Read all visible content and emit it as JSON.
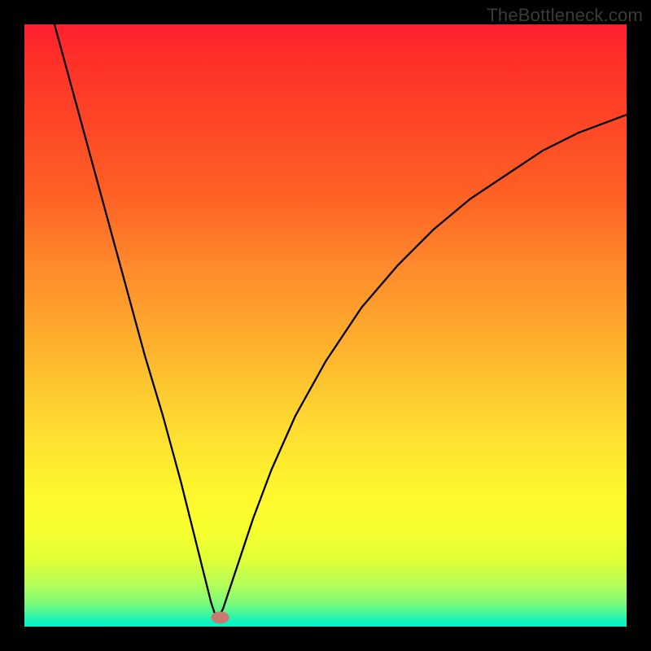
{
  "watermark": "TheBottleneck.com",
  "colors": {
    "background": "#000000",
    "gradient_top": "#FE2030",
    "gradient_mid_upper": "#FE892C",
    "gradient_mid": "#FEF82E",
    "gradient_lower": "#7FFB77",
    "gradient_bottom": "#01F1CD",
    "curve": "#000000",
    "marker": "#C97A70"
  },
  "chart_data": {
    "type": "line",
    "title": "",
    "xlabel": "",
    "ylabel": "",
    "xlim": [
      0,
      100
    ],
    "ylim": [
      0,
      100
    ],
    "min_x": 32,
    "marker": {
      "x": 32.5,
      "y": 1.5,
      "rx": 1.5,
      "ry": 1.0
    },
    "series": [
      {
        "name": "bottleneck-curve",
        "x": [
          5,
          8,
          11,
          14,
          17,
          20,
          23,
          26,
          28,
          30,
          31,
          32,
          33,
          34,
          36,
          38,
          41,
          45,
          50,
          56,
          62,
          68,
          74,
          80,
          86,
          92,
          100
        ],
        "y": [
          100,
          89,
          78,
          67,
          56,
          45,
          35,
          24,
          16,
          8,
          4,
          1,
          3,
          6,
          12,
          18,
          26,
          35,
          44,
          53,
          60,
          66,
          71,
          75,
          79,
          82,
          85
        ]
      }
    ]
  }
}
